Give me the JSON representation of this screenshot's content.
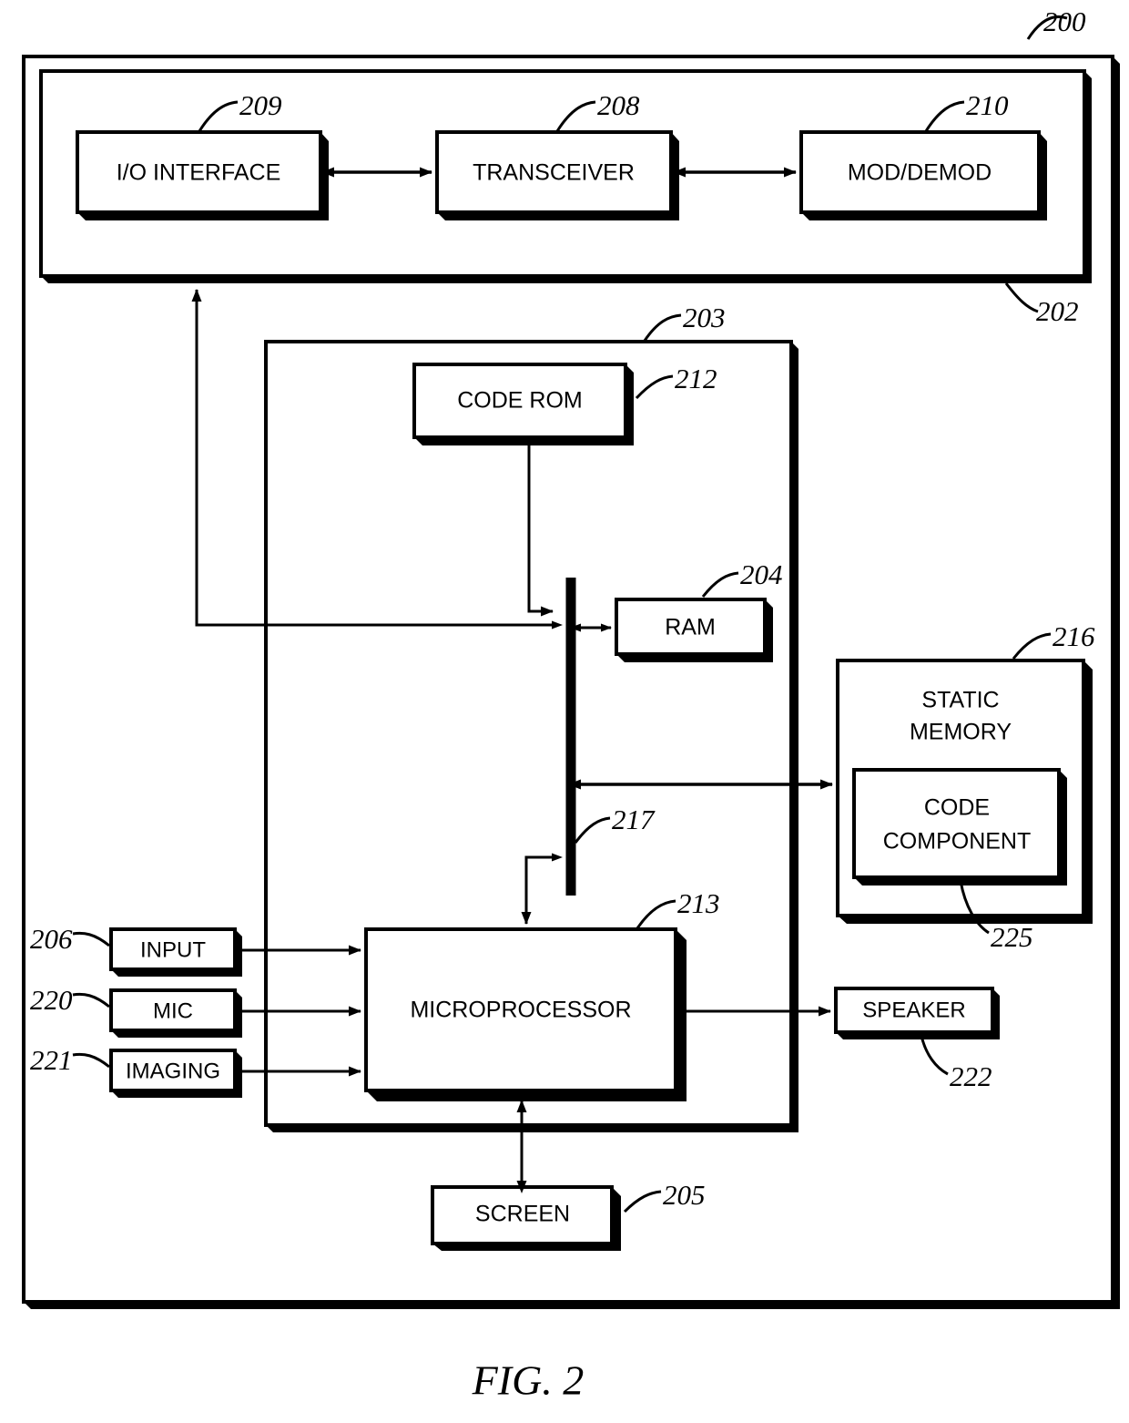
{
  "figure": {
    "caption": "FIG. 2",
    "outer_ref": "200",
    "housing_ref": "202",
    "inner_ref": "203"
  },
  "blocks": {
    "io_interface": {
      "label": "I/O INTERFACE",
      "ref": "209"
    },
    "transceiver": {
      "label": "TRANSCEIVER",
      "ref": "208"
    },
    "mod_demod": {
      "label": "MOD/DEMOD",
      "ref": "210"
    },
    "code_rom": {
      "label": "CODE ROM",
      "ref": "212"
    },
    "ram": {
      "label": "RAM",
      "ref": "204"
    },
    "static_memory": {
      "label_line1": "STATIC",
      "label_line2": "MEMORY",
      "ref": "216"
    },
    "code_component": {
      "label_line1": "CODE",
      "label_line2": "COMPONENT",
      "ref": "225"
    },
    "bus": {
      "ref": "217"
    },
    "microprocessor": {
      "label": "MICROPROCESSOR",
      "ref": "213"
    },
    "input": {
      "label": "INPUT",
      "ref": "206"
    },
    "mic": {
      "label": "MIC",
      "ref": "220"
    },
    "imaging": {
      "label": "IMAGING",
      "ref": "221"
    },
    "speaker": {
      "label": "SPEAKER",
      "ref": "222"
    },
    "screen": {
      "label": "SCREEN",
      "ref": "205"
    }
  },
  "colors": {
    "ink": "#000000",
    "paper": "#ffffff"
  }
}
